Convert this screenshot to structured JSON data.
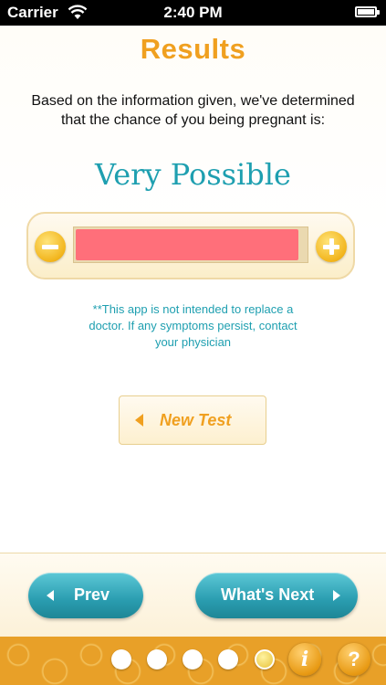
{
  "status_bar": {
    "carrier": "Carrier",
    "time": "2:40 PM"
  },
  "results": {
    "title": "Results",
    "intro": "Based on the information given, we've determined that the chance of you being pregnant is:",
    "likelihood": "Very Possible",
    "meter_level_percent": 97,
    "meter_fill_color": "#ff6f7a",
    "disclaimer": "**This app is not intended to replace a doctor. If any symptoms persist, contact your physician",
    "new_test_label": "New Test"
  },
  "nav": {
    "prev_label": "Prev",
    "next_label": "What's Next"
  },
  "footer": {
    "page_dots": 5,
    "active_dot": 5,
    "info_label": "i",
    "help_label": "?"
  },
  "colors": {
    "accent_orange": "#f0a020",
    "accent_teal": "#1e9fb0"
  }
}
